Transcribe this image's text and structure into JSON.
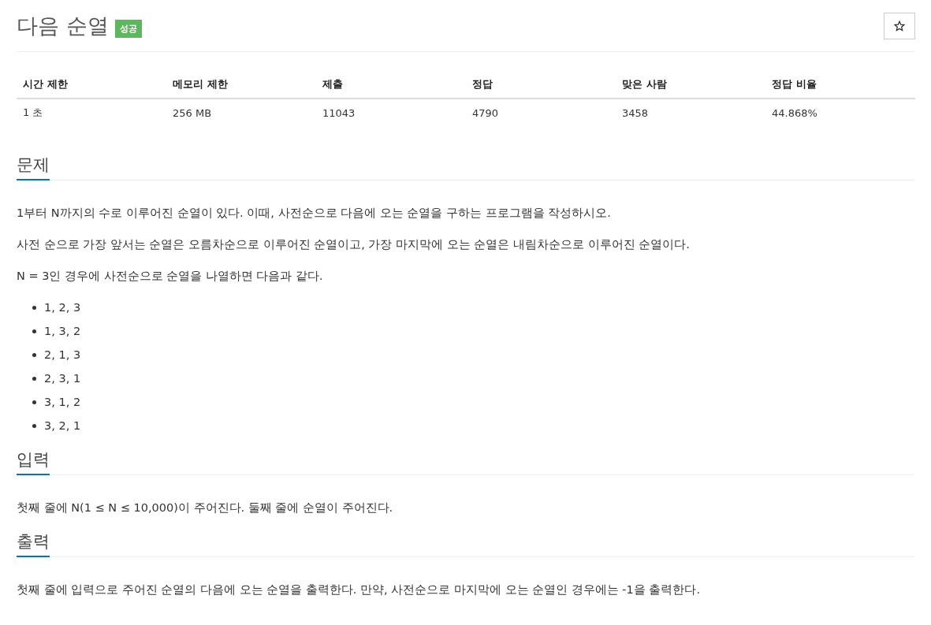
{
  "title": "다음 순열",
  "badge": "성공",
  "info_table": {
    "columns": [
      "시간 제한",
      "메모리 제한",
      "제출",
      "정답",
      "맞은 사람",
      "정답 비율"
    ],
    "rows": [
      [
        "1 초",
        "256 MB",
        "11043",
        "4790",
        "3458",
        "44.868%"
      ]
    ]
  },
  "sections": [
    {
      "title": "문제",
      "blocks": [
        {
          "kind": "paragraph",
          "text": "1부터 N까지의 수로 이루어진 순열이 있다. 이때, 사전순으로 다음에 오는 순열을 구하는 프로그램을 작성하시오."
        },
        {
          "kind": "paragraph",
          "text": "사전 순으로 가장 앞서는 순열은 오름차순으로 이루어진 순열이고, 가장 마지막에 오는 순열은 내림차순으로 이루어진 순열이다."
        },
        {
          "kind": "paragraph",
          "text": "N = 3인 경우에 사전순으로 순열을 나열하면 다음과 같다."
        },
        {
          "kind": "list",
          "items": [
            "1, 2, 3",
            "1, 3, 2",
            "2, 1, 3",
            "2, 3, 1",
            "3, 1, 2",
            "3, 2, 1"
          ]
        }
      ]
    },
    {
      "title": "입력",
      "blocks": [
        {
          "kind": "paragraph",
          "text": "첫째 줄에 N(1 ≤ N ≤ 10,000)이 주어진다. 둘째 줄에 순열이 주어진다."
        }
      ]
    },
    {
      "title": "출력",
      "blocks": [
        {
          "kind": "paragraph",
          "text": "첫째 줄에 입력으로 주어진 순열의 다음에 오는 순열을 출력한다. 만약, 사전순으로 마지막에 오는 순열인 경우에는 -1을 출력한다."
        }
      ]
    }
  ]
}
